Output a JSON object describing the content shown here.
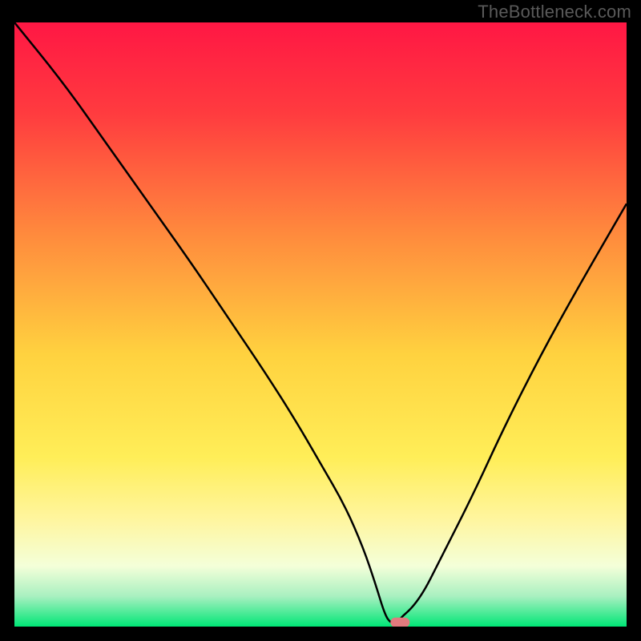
{
  "watermark": "TheBottleneck.com",
  "chart_data": {
    "type": "line",
    "title": "",
    "xlabel": "",
    "ylabel": "",
    "xlim": [
      0,
      100
    ],
    "ylim": [
      0,
      100
    ],
    "background_gradient": {
      "stops": [
        {
          "offset": 0,
          "color": "#ff1744"
        },
        {
          "offset": 15,
          "color": "#ff3b3f"
        },
        {
          "offset": 35,
          "color": "#ff8a3d"
        },
        {
          "offset": 55,
          "color": "#ffd23f"
        },
        {
          "offset": 72,
          "color": "#ffee58"
        },
        {
          "offset": 82,
          "color": "#fff59d"
        },
        {
          "offset": 90,
          "color": "#f4ffd9"
        },
        {
          "offset": 95,
          "color": "#a8f0c0"
        },
        {
          "offset": 100,
          "color": "#00e676"
        }
      ]
    },
    "series": [
      {
        "name": "bottleneck-curve",
        "x": [
          0,
          8,
          15,
          22,
          29,
          35,
          41,
          46,
          50,
          54,
          57,
          59,
          60.5,
          61.5,
          63,
          64.5,
          62,
          66,
          70,
          75,
          80,
          86,
          92,
          100
        ],
        "values": [
          100,
          90,
          80,
          70,
          60,
          51,
          42,
          34,
          27,
          20,
          13,
          7,
          2,
          0.5,
          0.5,
          0.5,
          0.5,
          4,
          12,
          22,
          33,
          45,
          56,
          70
        ]
      }
    ],
    "marker": {
      "x": 63,
      "y": 0.7,
      "color": "#e17a7e"
    }
  }
}
